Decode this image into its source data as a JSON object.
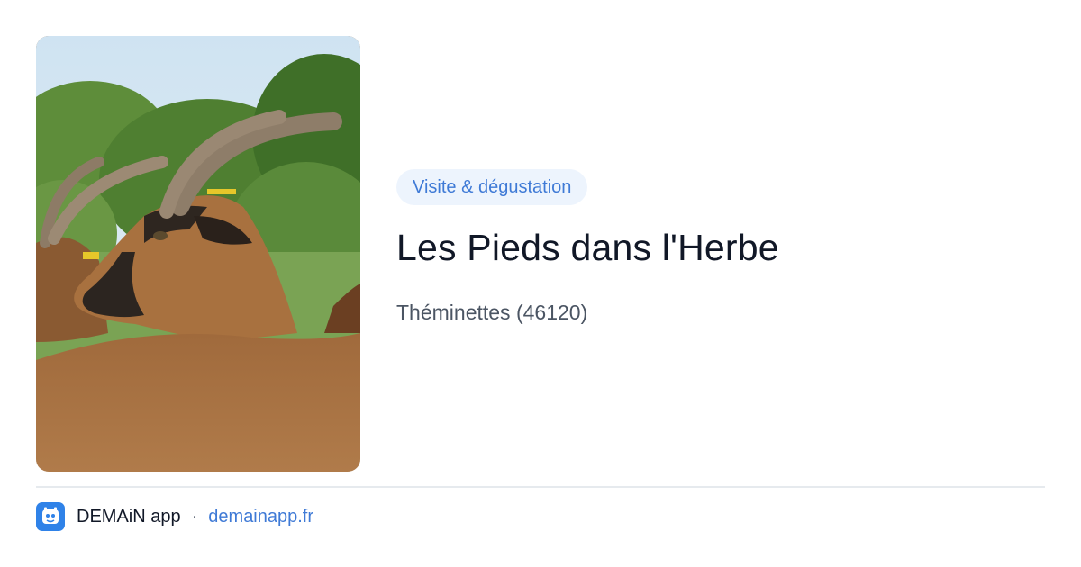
{
  "card": {
    "image_alt": "goats with horns in a meadow",
    "category_badge": "Visite & dégustation",
    "title": "Les Pieds dans l'Herbe",
    "location": "Théminettes (46120)"
  },
  "footer": {
    "app_name": "DEMAiN app",
    "separator": "·",
    "url": "demainapp.fr",
    "app_icon": "demain-app-icon"
  },
  "colors": {
    "badge_bg": "#edf4fd",
    "accent": "#3f7ad6",
    "title": "#111827",
    "muted": "#4b5563",
    "app_icon_bg": "#2f82e8"
  }
}
